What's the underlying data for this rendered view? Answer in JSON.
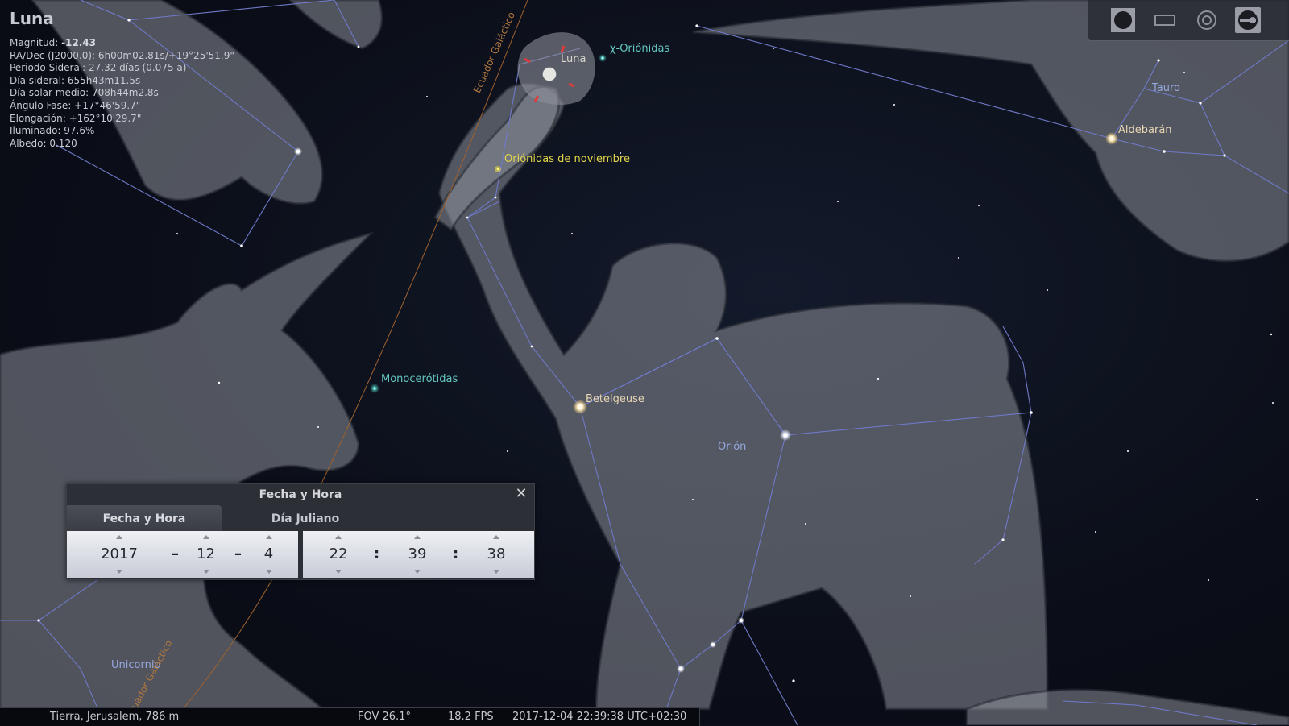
{
  "object_info": {
    "title": "Luna",
    "rows": [
      {
        "label": "Magnitud: ",
        "value": "-12.43"
      },
      {
        "label": "RA/Dec (J2000.0): 6h00m02.81s/+19°25'51.9\"",
        "value": ""
      },
      {
        "label": "Periodo Sideral: 27.32 días (0.075 a)",
        "value": ""
      },
      {
        "label": "Día sideral: 655h43m11.5s",
        "value": ""
      },
      {
        "label": "Día solar medio: 708h44m2.8s",
        "value": ""
      },
      {
        "label": "Ángulo Fase: +17°46'59.7\"",
        "value": ""
      },
      {
        "label": "Elongación: +162°10'29.7\"",
        "value": ""
      },
      {
        "label": "Iluminado: 97.6%",
        "value": ""
      },
      {
        "label": "Albedo: 0.120",
        "value": ""
      }
    ]
  },
  "toolbar": {
    "icons": [
      "circle-icon",
      "rectangle-icon",
      "target-icon",
      "wrench-icon"
    ],
    "active_index": 3
  },
  "sky_labels": {
    "moon": "Luna",
    "chi_orionids": "χ-Oriónidas",
    "nov_orionids": "Oriónidas de noviembre",
    "monocerotids": "Monocerótidas",
    "betelgeuse": "Betelgeuse",
    "orion": "Orión",
    "taurus": "Tauro",
    "aldebaran": "Aldebarán",
    "monoceros": "Unicornio",
    "galactic_equator_top": "Ecuador Galáctico",
    "galactic_equator_bottom": "Ecuador Galáctico"
  },
  "dialog": {
    "title": "Fecha y Hora",
    "tabs": [
      "Fecha y Hora",
      "Día Juliano"
    ],
    "date": {
      "year": "2017",
      "month": "12",
      "day": "4",
      "sep": "–"
    },
    "time": {
      "hour": "22",
      "minute": "39",
      "second": "38",
      "sep": ":"
    }
  },
  "status_bar": {
    "location": "Tierra, Jerusalem, 786 m",
    "fov": "FOV 26.1°",
    "fps": "18.2 FPS",
    "datetime": "2017-12-04 22:39:38 UTC+02:30"
  },
  "colors": {
    "constellation_lines": "#6f79c8",
    "galactic_equator": "#a0622e",
    "art": "#8f939d"
  }
}
